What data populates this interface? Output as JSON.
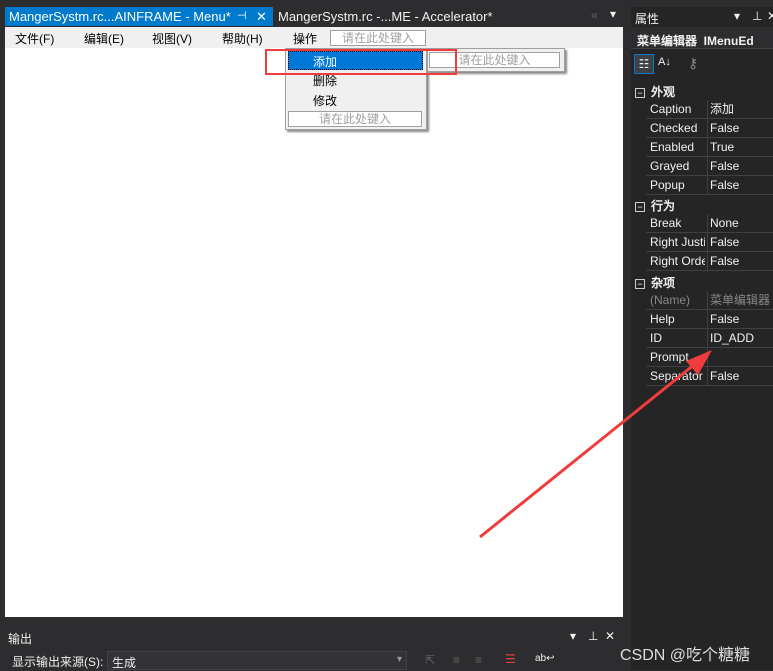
{
  "tabs": [
    {
      "label": "MangerSystm.rc...AINFRAME - Menu*",
      "active": true
    },
    {
      "label": "MangerSystm.rc -...ME - Accelerator*",
      "active": false
    }
  ],
  "tab_icons": {
    "pin": "⊣",
    "close": "✕",
    "overflow": "«",
    "dropdown": "▾"
  },
  "menubar": {
    "items": [
      "文件(F)",
      "编辑(E)",
      "视图(V)",
      "帮助(H)",
      "操作"
    ],
    "placeholder": "请在此处键入"
  },
  "dropdown": {
    "items": [
      "添加",
      "删除",
      "修改"
    ],
    "placeholder": "请在此处键入",
    "submenu_placeholder": "请在此处键入",
    "selected": "添加"
  },
  "properties": {
    "title": "属性",
    "object": "菜单编辑器  IMenuEd",
    "sections": [
      {
        "name": "外观",
        "rows": [
          [
            "Caption",
            "添加"
          ],
          [
            "Checked",
            "False"
          ],
          [
            "Enabled",
            "True"
          ],
          [
            "Grayed",
            "False"
          ],
          [
            "Popup",
            "False"
          ]
        ]
      },
      {
        "name": "行为",
        "rows": [
          [
            "Break",
            "None"
          ],
          [
            "Right Justify",
            "False"
          ],
          [
            "Right Order",
            "False"
          ]
        ]
      },
      {
        "name": "杂项",
        "rows": [
          [
            "(Name)",
            "菜单编辑器"
          ],
          [
            "Help",
            "False"
          ],
          [
            "ID",
            "ID_ADD"
          ],
          [
            "Prompt",
            ""
          ],
          [
            "Separator",
            "False"
          ]
        ]
      }
    ]
  },
  "output": {
    "title": "输出",
    "source_label": "显示输出来源(S):",
    "source_value": "生成"
  },
  "watermark": "CSDN @吃个糖糖",
  "colors": {
    "accent": "#007acc",
    "annotation": "#f03c3c"
  }
}
